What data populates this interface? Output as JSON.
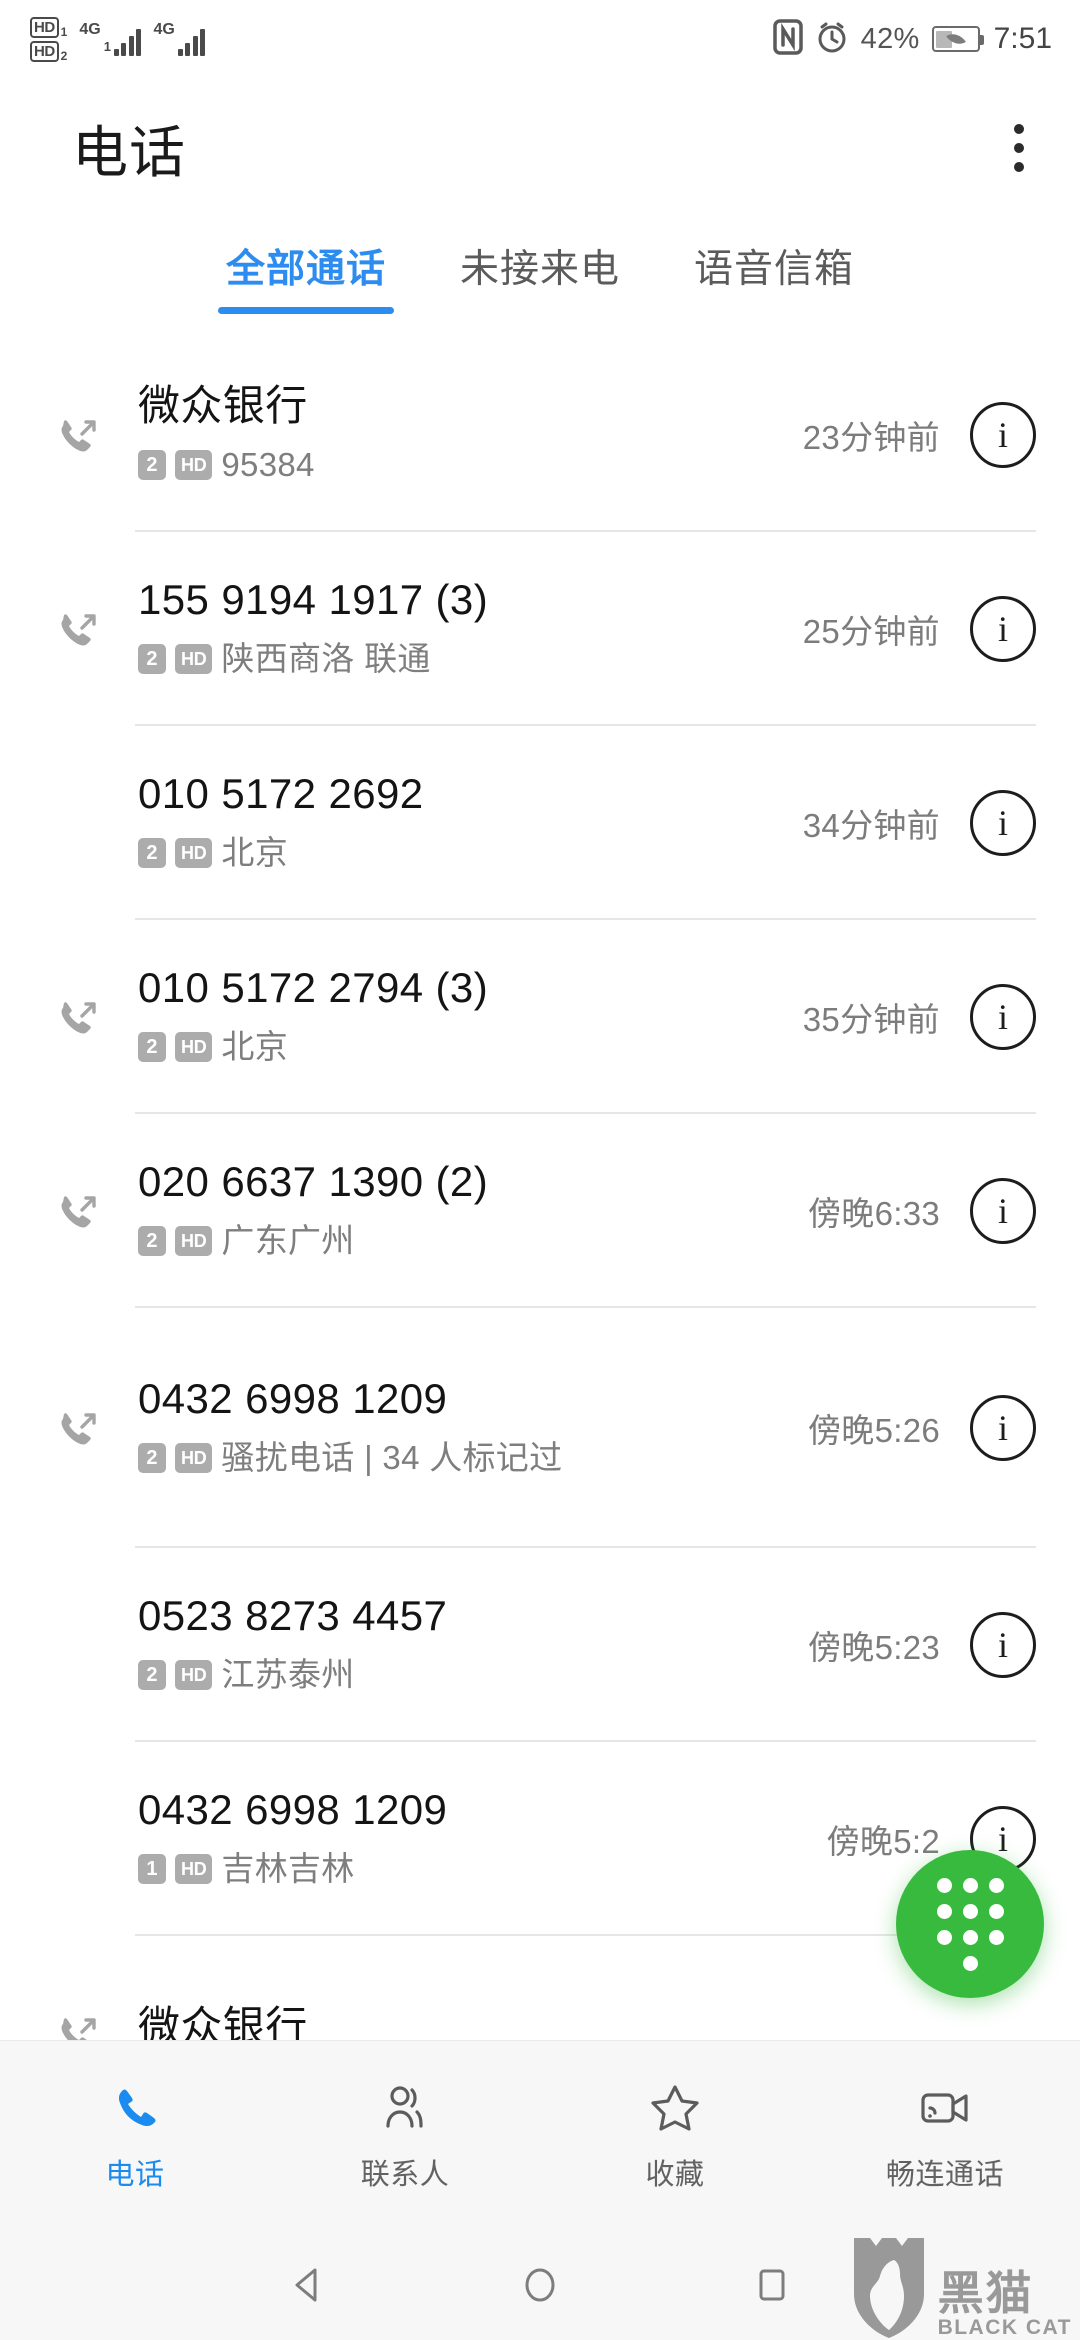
{
  "statusbar": {
    "hd1_label": "HD",
    "hd1_sim": "1",
    "hd2_label": "HD",
    "hd2_sim": "2",
    "net1": "4G",
    "sim1_index": "1",
    "net2": "4G",
    "nfc_icon": "nfc-icon",
    "alarm_icon": "alarm-icon",
    "battery_percent": "42%",
    "battery_icon": "battery-saver-icon",
    "time": "7:51"
  },
  "appbar": {
    "title": "电话",
    "overflow_icon": "more-vertical-icon"
  },
  "tabs": [
    {
      "label": "全部通话",
      "active": true
    },
    {
      "label": "未接来电",
      "active": false
    },
    {
      "label": "语音信箱",
      "active": false
    }
  ],
  "calls": [
    {
      "name": "微众银行",
      "sim": "2",
      "hd": "HD",
      "detail": "95384",
      "time": "23分钟前",
      "call_type": "outgoing",
      "info_label": "i"
    },
    {
      "name": "155 9194 1917 (3)",
      "sim": "2",
      "hd": "HD",
      "detail": "陕西商洛 联通",
      "time": "25分钟前",
      "call_type": "outgoing",
      "info_label": "i"
    },
    {
      "name": "010 5172 2692",
      "sim": "2",
      "hd": "HD",
      "detail": "北京",
      "time": "34分钟前",
      "call_type": "none",
      "info_label": "i"
    },
    {
      "name": "010 5172 2794 (3)",
      "sim": "2",
      "hd": "HD",
      "detail": "北京",
      "time": "35分钟前",
      "call_type": "outgoing",
      "info_label": "i"
    },
    {
      "name": "020 6637 1390 (2)",
      "sim": "2",
      "hd": "HD",
      "detail": "广东广州",
      "time": "傍晚6:33",
      "call_type": "outgoing",
      "info_label": "i"
    },
    {
      "name": "0432 6998 1209",
      "sim": "2",
      "hd": "HD",
      "detail": "骚扰电话 | 34 人标记过",
      "time": "傍晚5:26",
      "call_type": "outgoing",
      "info_label": "i",
      "two_line": true
    },
    {
      "name": "0523 8273 4457",
      "sim": "2",
      "hd": "HD",
      "detail": "江苏泰州",
      "time": "傍晚5:23",
      "call_type": "none",
      "info_label": "i"
    },
    {
      "name": "0432 6998 1209",
      "sim": "1",
      "hd": "HD",
      "detail": "吉林吉林",
      "time": "傍晚5:2",
      "call_type": "none",
      "info_label": "i"
    },
    {
      "name": "微众银行",
      "sim": "",
      "hd": "",
      "detail": "",
      "time": "",
      "call_type": "outgoing",
      "info_label": ""
    }
  ],
  "fab": {
    "name": "dialpad-fab",
    "color": "#37ba3d",
    "icon": "dialpad-icon"
  },
  "bottomnav": [
    {
      "label": "电话",
      "icon": "phone-icon",
      "active": true
    },
    {
      "label": "联系人",
      "icon": "contacts-icon",
      "active": false
    },
    {
      "label": "收藏",
      "icon": "star-icon",
      "active": false
    },
    {
      "label": "畅连通话",
      "icon": "video-call-icon",
      "active": false
    }
  ],
  "androidnav": {
    "back_icon": "back-triangle-icon",
    "home_icon": "home-circle-icon",
    "recents_icon": "recents-square-icon"
  },
  "watermark": {
    "cn": "黑猫",
    "en": "BLACK CAT",
    "icon": "black-cat-shield-icon"
  },
  "colors": {
    "accent_blue": "#2d8cf0",
    "nav_blue": "#1a8cf0",
    "fab_green": "#37ba3d",
    "badge_gray": "#acacac"
  }
}
